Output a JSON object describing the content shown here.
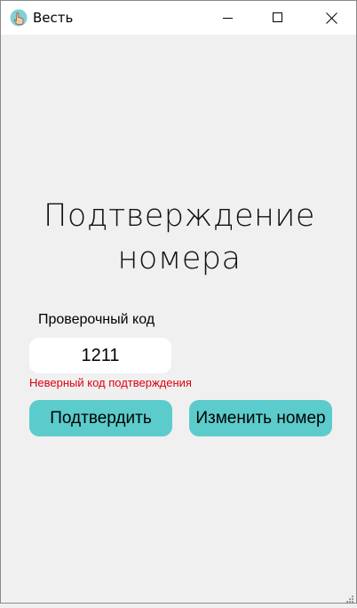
{
  "window": {
    "title": "Весть",
    "icon": "hand-pointer-icon"
  },
  "page": {
    "heading_line1": "Подтверждение",
    "heading_line2": "номера",
    "code_label": "Проверочный код",
    "code_value": "1211",
    "error_text": "Неверный код подтверждения",
    "confirm_button": "Подтвердить",
    "change_button": "Изменить номер"
  },
  "colors": {
    "accent": "#5ccbcc",
    "error": "#e0000f",
    "background": "#f0f0f0"
  }
}
